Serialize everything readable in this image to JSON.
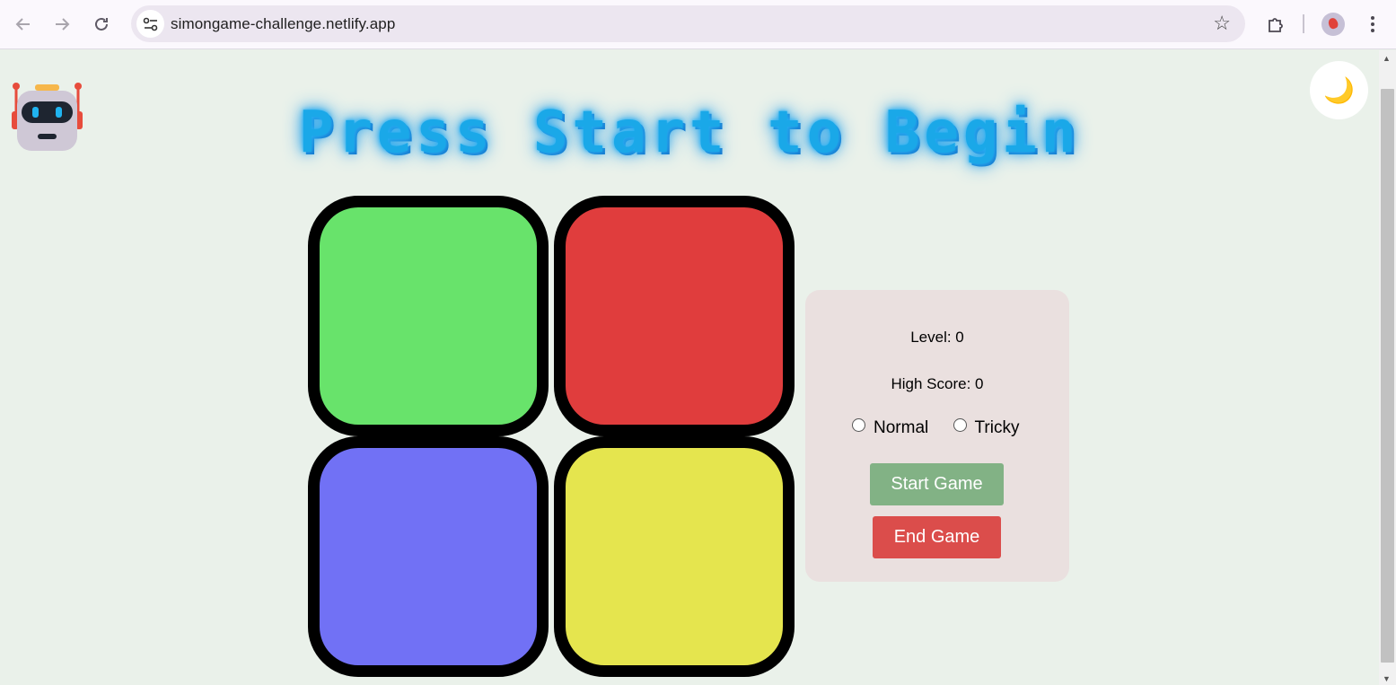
{
  "browser": {
    "url": "simongame-challenge.netlify.app",
    "icons": [
      "back-arrow-icon",
      "forward-arrow-icon",
      "reload-icon",
      "site-info-icon",
      "bookmark-star-icon",
      "extensions-icon",
      "profile-avatar",
      "more-menu-icon"
    ]
  },
  "page": {
    "title": "Press Start to Begin",
    "theme_toggle_icon": "🌙",
    "pads": [
      {
        "color_name": "green",
        "color": "#68e36b"
      },
      {
        "color_name": "red",
        "color": "#e03d3d"
      },
      {
        "color_name": "blue",
        "color": "#7171f5"
      },
      {
        "color_name": "yellow",
        "color": "#e5e54e"
      }
    ],
    "panel": {
      "level_text": "Level: 0",
      "high_score_text": "High Score: 0",
      "modes": [
        "Normal",
        "Tricky"
      ],
      "start_label": "Start Game",
      "end_label": "End Game"
    },
    "colors": {
      "title_glow": "#1aa8e8",
      "start_button": "#82b285",
      "end_button": "#db4d4b",
      "background": "#eaf1ea"
    }
  }
}
